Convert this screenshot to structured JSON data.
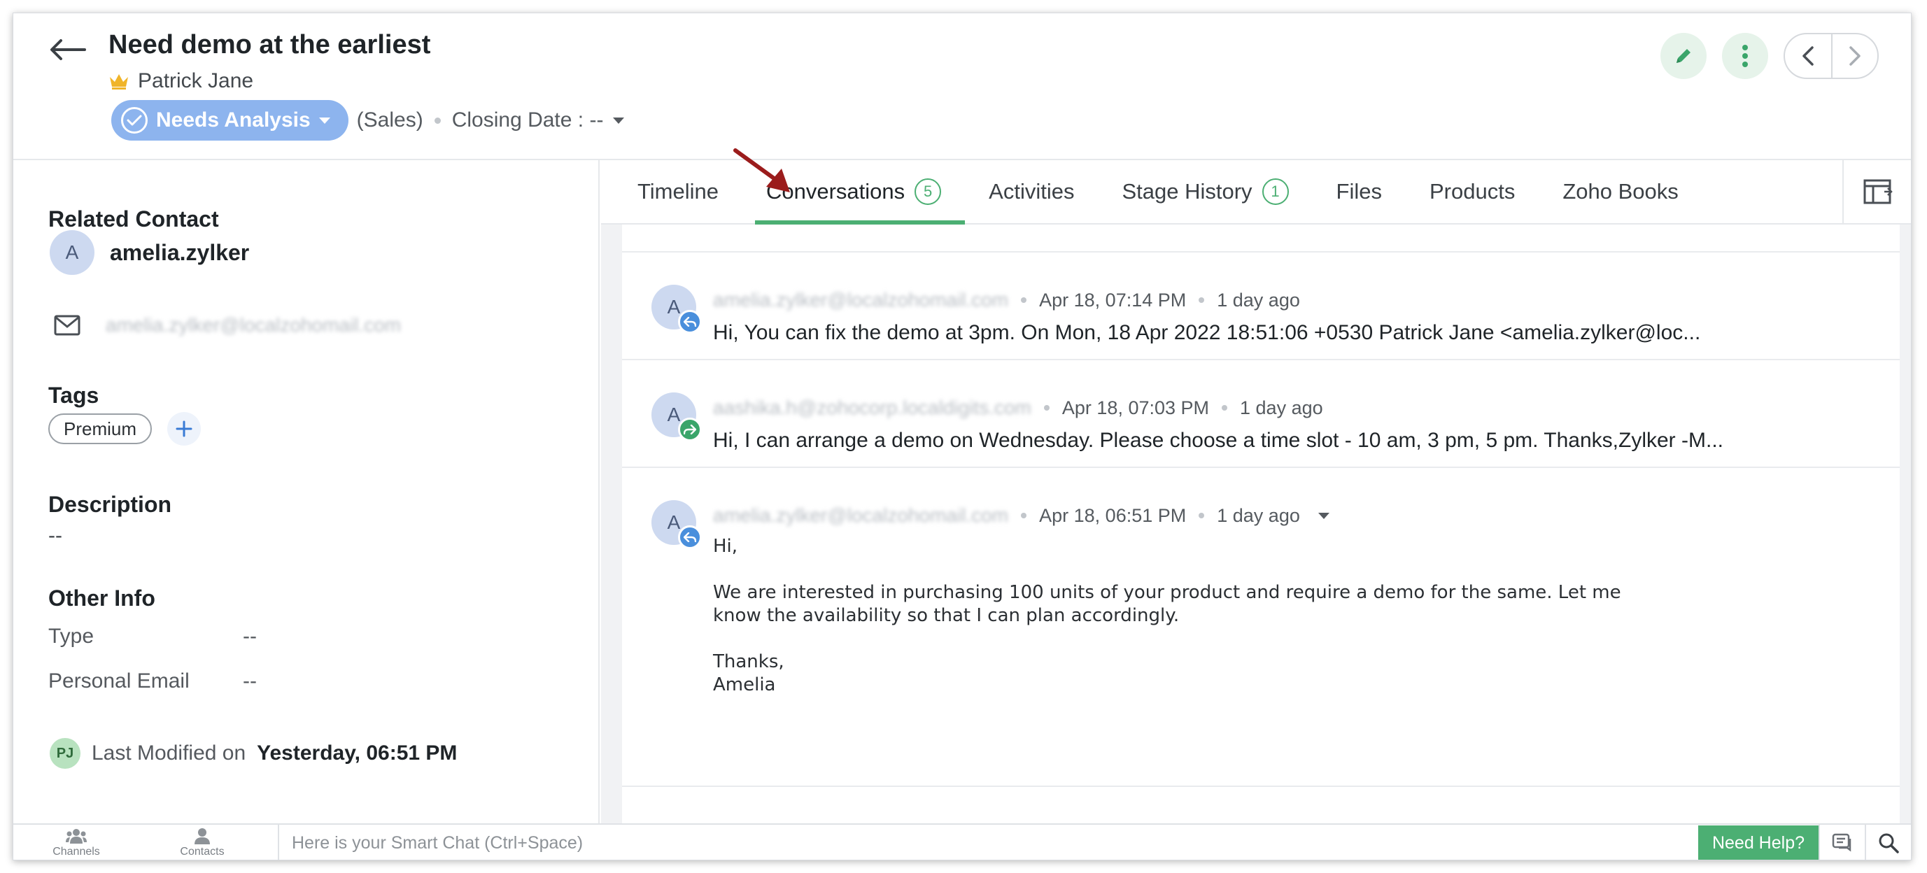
{
  "header": {
    "title": "Need demo at the earliest",
    "owner": "Patrick Jane",
    "stage": "Needs Analysis",
    "pipeline": "(Sales)",
    "closing_date": "Closing Date : --"
  },
  "left_panel": {
    "related_contact_title": "Related Contact",
    "contact_initial": "A",
    "contact_name": "amelia.zylker",
    "contact_email": "amelia.zylker@localzohomail.com",
    "tags_title": "Tags",
    "tags": [
      "Premium"
    ],
    "description_title": "Description",
    "description_value": "--",
    "other_info_title": "Other Info",
    "type_label": "Type",
    "type_value": "--",
    "personal_email_label": "Personal Email",
    "personal_email_value": "--",
    "modified_initials": "PJ",
    "modified_label": "Last Modified on",
    "modified_value": "Yesterday, 06:51 PM"
  },
  "tabs": [
    {
      "label": "Timeline"
    },
    {
      "label": "Conversations",
      "count": "5"
    },
    {
      "label": "Activities"
    },
    {
      "label": "Stage History",
      "count": "1"
    },
    {
      "label": "Files"
    },
    {
      "label": "Products"
    },
    {
      "label": "Zoho Books"
    }
  ],
  "conversations": [
    {
      "initial": "A",
      "sender": "amelia.zylker@localzohomail.com",
      "date": "Apr 18, 07:14 PM",
      "ago": "1 day ago",
      "snippet": "Hi, You can fix the demo at 3pm. On Mon, 18 Apr 2022 18:51:06 +0530 Patrick Jane <amelia.zylker@loc..."
    },
    {
      "initial": "A",
      "sender": "aashika.h@zohocorp.localdigits.com",
      "date": "Apr 18, 07:03 PM",
      "ago": "1 day ago",
      "snippet": "Hi, I can arrange a demo on Wednesday. Please choose a time slot - 10 am, 3 pm, 5 pm. Thanks,Zylker -M..."
    },
    {
      "initial": "A",
      "sender": "amelia.zylker@localzohomail.com",
      "date": "Apr 18, 06:51 PM",
      "ago": "1 day ago",
      "body_greeting": "Hi,",
      "body_line1": "We are interested in purchasing 100 units of your product and require a demo for the same. Let me",
      "body_line2": "know the availability so that I can plan accordingly.",
      "body_signoff": "Thanks,",
      "body_name": "Amelia"
    }
  ],
  "bottom_bar": {
    "channels": "Channels",
    "contacts": "Contacts",
    "chat_placeholder": "Here is your Smart Chat (Ctrl+Space)",
    "need_help": "Need Help?"
  },
  "colors": {
    "accent_green": "#4caf73",
    "stage_blue": "#8db4ee",
    "annotation_red": "#9b1c1c"
  }
}
